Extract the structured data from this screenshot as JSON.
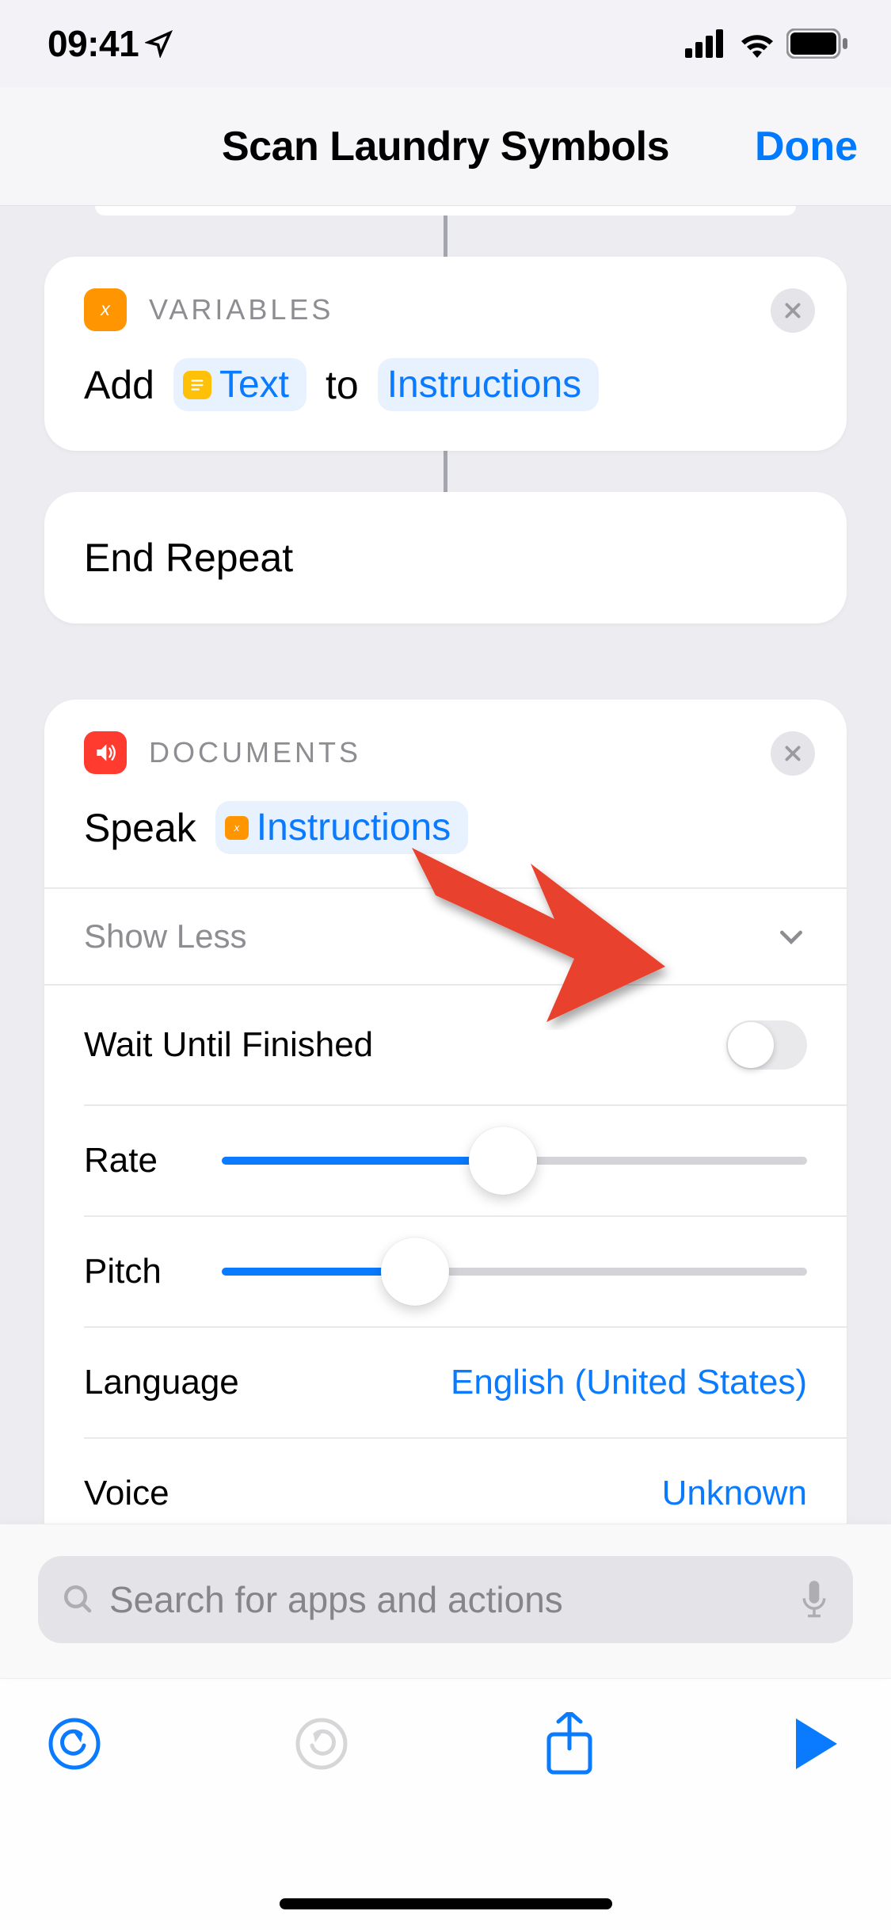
{
  "status": {
    "time": "09:41"
  },
  "header": {
    "title": "Scan Laundry Symbols",
    "done": "Done"
  },
  "variables_card": {
    "category": "VARIABLES",
    "add": "Add",
    "text_token": "Text",
    "to": "to",
    "instructions_token": "Instructions"
  },
  "end_repeat": {
    "label": "End Repeat"
  },
  "speak_card": {
    "category": "DOCUMENTS",
    "speak": "Speak",
    "instructions_token": "Instructions",
    "show_less": "Show Less",
    "wait_label": "Wait Until Finished",
    "wait_value": false,
    "rate_label": "Rate",
    "rate_value": 0.48,
    "pitch_label": "Pitch",
    "pitch_value": 0.33,
    "language_label": "Language",
    "language_value": "English (United States)",
    "voice_label": "Voice",
    "voice_value": "Unknown"
  },
  "documents_card": {
    "category": "DOCUMENTS"
  },
  "search": {
    "placeholder": "Search for apps and actions"
  }
}
